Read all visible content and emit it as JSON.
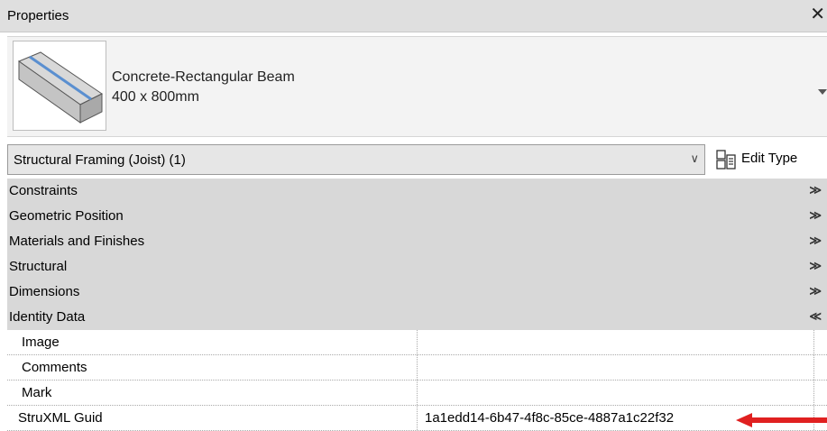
{
  "panel": {
    "title": "Properties",
    "close_glyph": "✕"
  },
  "type_selector": {
    "family": "Concrete-Rectangular Beam",
    "size": "400 x 800mm",
    "preview_icon": "beam-preview-icon"
  },
  "instance_selector": {
    "label": "Structural Framing (Joist) (1)",
    "edit_type_label": "Edit Type"
  },
  "groups": [
    {
      "label": "Constraints",
      "state": "collapsed"
    },
    {
      "label": "Geometric Position",
      "state": "collapsed"
    },
    {
      "label": "Materials and Finishes",
      "state": "collapsed"
    },
    {
      "label": "Structural",
      "state": "collapsed"
    },
    {
      "label": "Dimensions",
      "state": "collapsed"
    },
    {
      "label": "Identity Data",
      "state": "expanded"
    }
  ],
  "identity_params": [
    {
      "name": "Image",
      "value": ""
    },
    {
      "name": "Comments",
      "value": ""
    },
    {
      "name": "Mark",
      "value": ""
    },
    {
      "name": "StruXML Guid",
      "value": "1a1edd14-6b47-4f8c-85ce-4887a1c22f32"
    }
  ],
  "glyphs": {
    "collapsed": "≫",
    "expanded": "≪",
    "dropdown": "∨"
  },
  "colors": {
    "annotation_arrow": "#e02020",
    "group_bg": "#d8d8d8",
    "title_bg": "#dfdfdf"
  }
}
